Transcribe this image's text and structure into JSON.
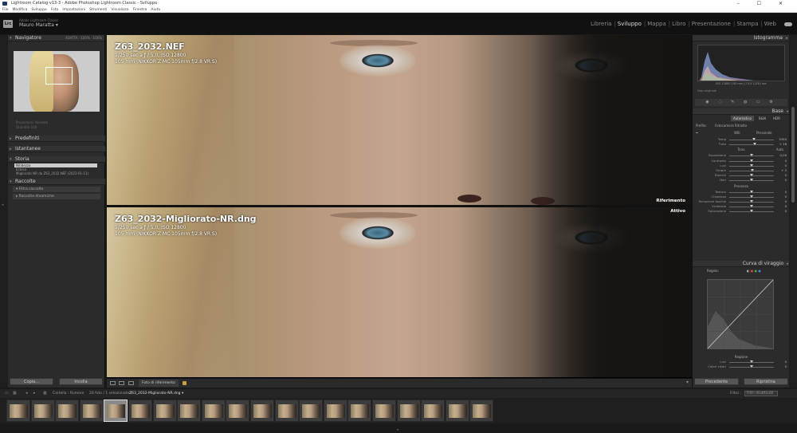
{
  "window": {
    "title": "Lightroom Catalog-v13-3 - Adobe Photoshop Lightroom Classic - Sviluppo",
    "controls": "– ☐ ✕"
  },
  "menu": [
    "File",
    "Modifica",
    "Sviluppo",
    "Foto",
    "Impostazioni",
    "Strumenti",
    "Visualizza",
    "Finestra",
    "Aiuto"
  ],
  "identity": {
    "logo": "Lrc",
    "app_small": "Adobe Lightroom Classic",
    "user": "Mauro Maratta ▾"
  },
  "modules": [
    {
      "label": "Libreria",
      "active": false
    },
    {
      "label": "Sviluppo",
      "active": true
    },
    {
      "label": "Mappa",
      "active": false
    },
    {
      "label": "Libro",
      "active": false
    },
    {
      "label": "Presentazione",
      "active": false
    },
    {
      "label": "Stampa",
      "active": false
    },
    {
      "label": "Web",
      "active": false
    }
  ],
  "left": {
    "navigator": {
      "title": "Navigatore",
      "options": "ADATTA · 100% · 100%"
    },
    "preset_dim": "Proporzioni    Variante",
    "preset_dim2": "Quantità                                        100",
    "sections": {
      "presets": "Predefiniti",
      "snapshots": "Istantanee",
      "history": "Storia",
      "collections": "Raccolte"
    },
    "history_items": [
      "Nitidezza",
      "Esteso",
      "Migliorato NR da Z63_2032.NEF (2023-01-11)"
    ],
    "collection_items": [
      "▾ Filtra raccolte",
      "▸  Raccolte dinamiche"
    ],
    "btn_copy": "Copia...",
    "btn_paste": "Incolla"
  },
  "viewer": {
    "top": {
      "title": "Z63_2032.NEF",
      "line1": "1/250 sec a ƒ / 5,0, ISO 12800",
      "line2": "105 mm (NIKKOR Z MC 105mm f/2.8 VR S)",
      "label": "Riferimento"
    },
    "bottom": {
      "title": "Z63_2032-Migliorato-NR.dng",
      "line1": "1/250 sec a ƒ / 5,0, ISO 12800",
      "line2": "105 mm (NIKKOR Z MC 105mm f/2.8 VR S)",
      "label": "Attivo"
    }
  },
  "toolbar": {
    "ref_label": "Foto di riferimento"
  },
  "right": {
    "histogram_title": "Istogramma",
    "hist_info": "ISO 12800   105 mm   ƒ / 5,0   1/250 sec",
    "hist_orig": "Foto originale",
    "tools": "◉ ◌ ✎ ◍ ▭ ⚙",
    "basic_title": "Base",
    "mode": [
      "Automatico",
      "B&N",
      "HDR"
    ],
    "profile_label": "Profilo:",
    "profile_value": "Fotocamera Ritratto",
    "wb_label": "WB:",
    "wb_value": "Personale",
    "sliders_wb": [
      {
        "label": "Temp",
        "value": "5350",
        "pos": 0.55
      },
      {
        "label": "Tinta",
        "value": "+ 16",
        "pos": 0.58
      }
    ],
    "tone_title": "Tono",
    "tone_auto": "Auto",
    "sliders_tone": [
      {
        "label": "Esposizione",
        "value": "0,00",
        "pos": 0.5
      },
      {
        "label": "Contrasto",
        "value": "0",
        "pos": 0.5
      },
      {
        "label": "Luci",
        "value": "0",
        "pos": 0.5
      },
      {
        "label": "Ombre",
        "value": "+ 2",
        "pos": 0.51
      },
      {
        "label": "Bianchi",
        "value": "0",
        "pos": 0.5
      },
      {
        "label": "Neri",
        "value": "0",
        "pos": 0.5
      }
    ],
    "presence_title": "Presenza",
    "sliders_presence": [
      {
        "label": "Texture",
        "value": "0",
        "pos": 0.5
      },
      {
        "label": "Chiarezza",
        "value": "0",
        "pos": 0.5
      },
      {
        "label": "Rimozione foschia",
        "value": "0",
        "pos": 0.5
      },
      {
        "label": "Vividezza",
        "value": "0",
        "pos": 0.5
      },
      {
        "label": "Saturazione",
        "value": "0",
        "pos": 0.5
      }
    ],
    "curve_title": "Curva di viraggio",
    "curve_region": "Regola:",
    "curve_adjust_title": "Regione",
    "sliders_curve": [
      {
        "label": "Luci",
        "value": "0",
        "pos": 0.5
      },
      {
        "label": "Colori chiari",
        "value": "0",
        "pos": 0.5
      }
    ],
    "btn_prev": "Precedente",
    "btn_reset": "Ripristina"
  },
  "filmstrip": {
    "path": "Cartella : Rumore",
    "count": "20 foto / 1 selezionate /",
    "filename": "Z63_2032-Migliorato-NR.dng ▾",
    "filter_label": "Filtro :",
    "filter_value": "Filtri disattivati",
    "selected_index": 4,
    "thumb_count": 20
  },
  "colors": {
    "accent_panel": "#2b2b2b",
    "header": "#323232",
    "background": "#1a1a1a"
  }
}
